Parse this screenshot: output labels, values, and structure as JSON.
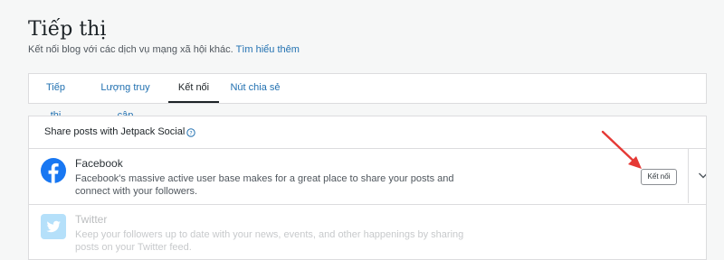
{
  "page": {
    "title": "Tiếp thị",
    "subtitle": "Kết nối blog với các dịch vụ mạng xã hội khác.",
    "learn_more": "Tìm hiểu thêm"
  },
  "tabs": [
    {
      "label": "Tiếp thị",
      "active": false
    },
    {
      "label": "Lượng truy cập",
      "active": false
    },
    {
      "label": "Kết nối",
      "active": true
    },
    {
      "label": "Nút chia sẻ",
      "active": false
    }
  ],
  "panel": {
    "header": "Share posts with Jetpack Social",
    "services": [
      {
        "name": "Facebook",
        "description": "Facebook's massive active user base makes for a great place to share your posts and connect with your followers.",
        "button_label": "Kết nối",
        "icon": "facebook-icon",
        "color": "#1877f2"
      },
      {
        "name": "Twitter",
        "description": "Keep your followers up to date with your news, events, and other happenings by sharing posts on your Twitter feed.",
        "icon": "twitter-icon",
        "color": "#1da1f2"
      }
    ]
  },
  "colors": {
    "link": "#2271b1",
    "annotation_arrow": "#e53935"
  }
}
